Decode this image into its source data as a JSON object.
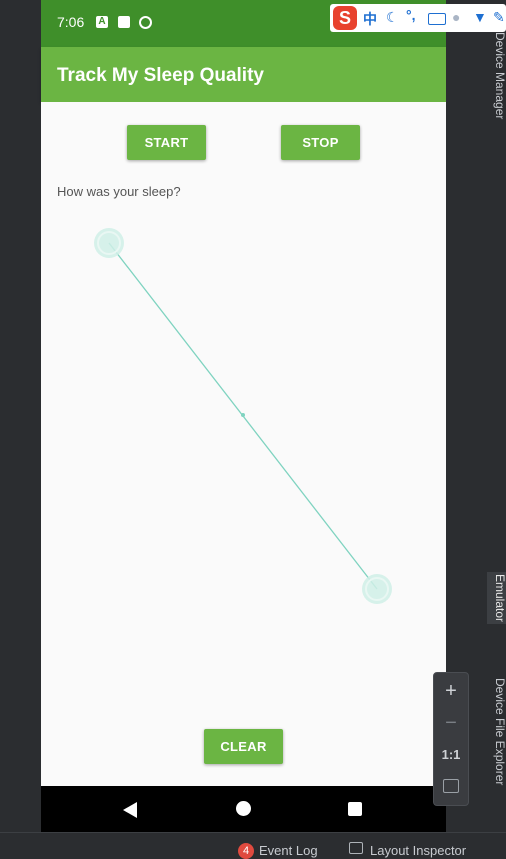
{
  "status_bar": {
    "time": "7:06",
    "icons": [
      "a-icon",
      "sd-card-icon",
      "sync-icon"
    ]
  },
  "app": {
    "title": "Track My Sleep Quality"
  },
  "buttons": {
    "start": "START",
    "stop": "STOP",
    "clear": "CLEAR"
  },
  "question": "How was your sleep?",
  "nav_icons": [
    "back-icon",
    "home-icon",
    "recents-icon"
  ],
  "ime_toolbar": {
    "logo": "S",
    "mode": "中",
    "punct": "°,"
  },
  "ide": {
    "right_tabs": [
      "Device Manager",
      "Emulator",
      "Device File Explorer"
    ],
    "zoom": {
      "plus": "+",
      "minus": "−",
      "one_to_one": "1:1"
    },
    "bottom": {
      "event_count": "4",
      "event_log": "Event Log",
      "layout_inspector": "Layout Inspector"
    }
  },
  "colors": {
    "primary": "#6bb543",
    "primary_dark": "#3f8f2a",
    "accent": "#7fd3c0"
  }
}
